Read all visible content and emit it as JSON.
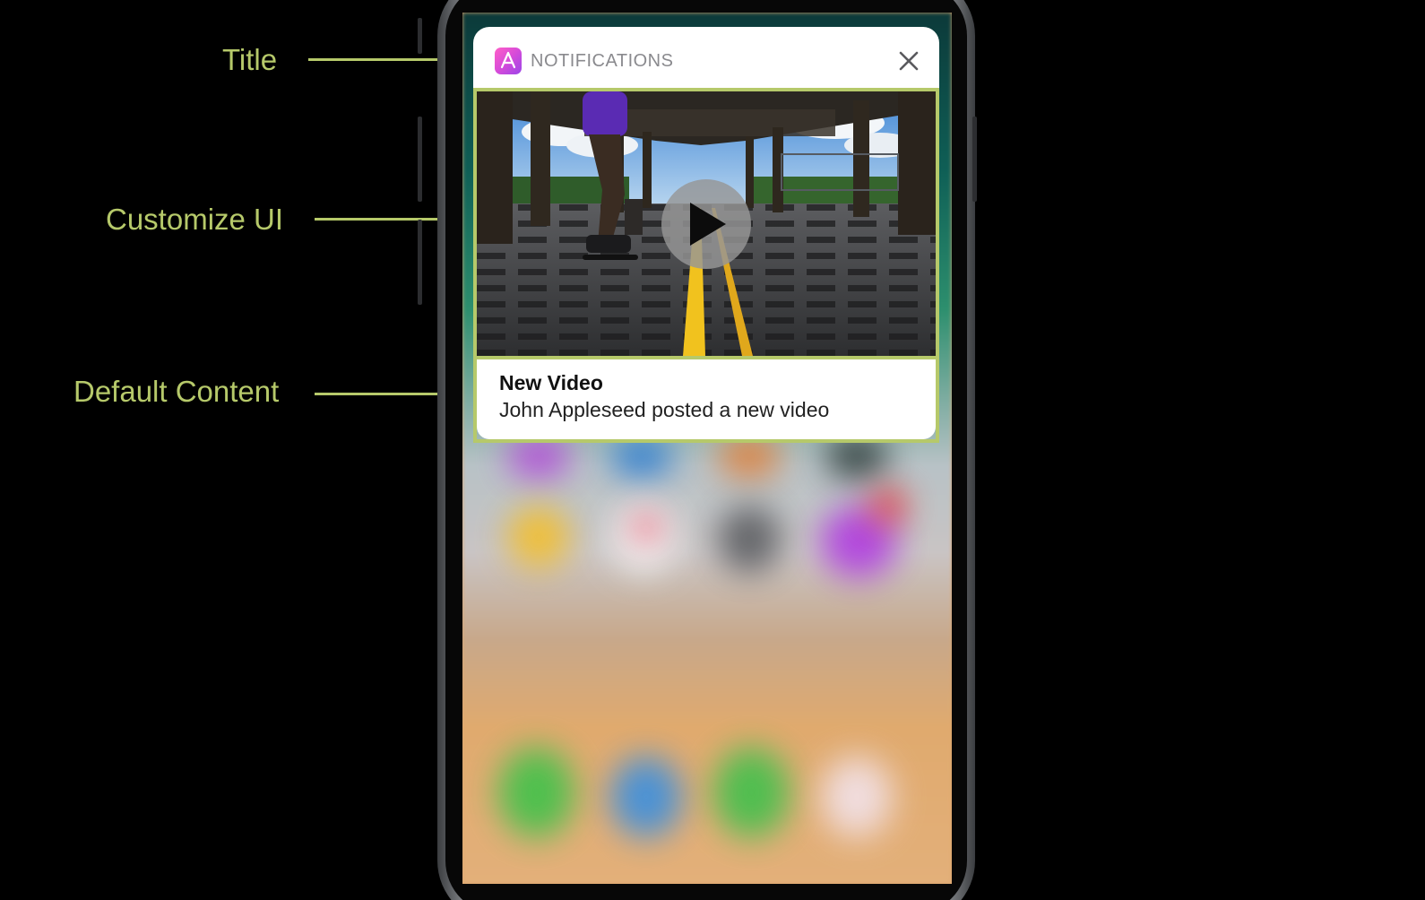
{
  "annotations": {
    "title_label": "Title",
    "custom_ui_label": "Customize UI",
    "default_content_label": "Default Content",
    "accent_color": "#b6c96a"
  },
  "notification": {
    "app_name": "NOTIFICATIONS",
    "app_icon": "app-store-icon",
    "close_icon": "close-icon",
    "title": "New Video",
    "message": "John Appleseed posted a new video"
  },
  "media": {
    "thumbnail": "skateboarder-under-elevated-railway-photo",
    "play_icon": "play-icon"
  },
  "wallpaper": "blurred-home-screen"
}
